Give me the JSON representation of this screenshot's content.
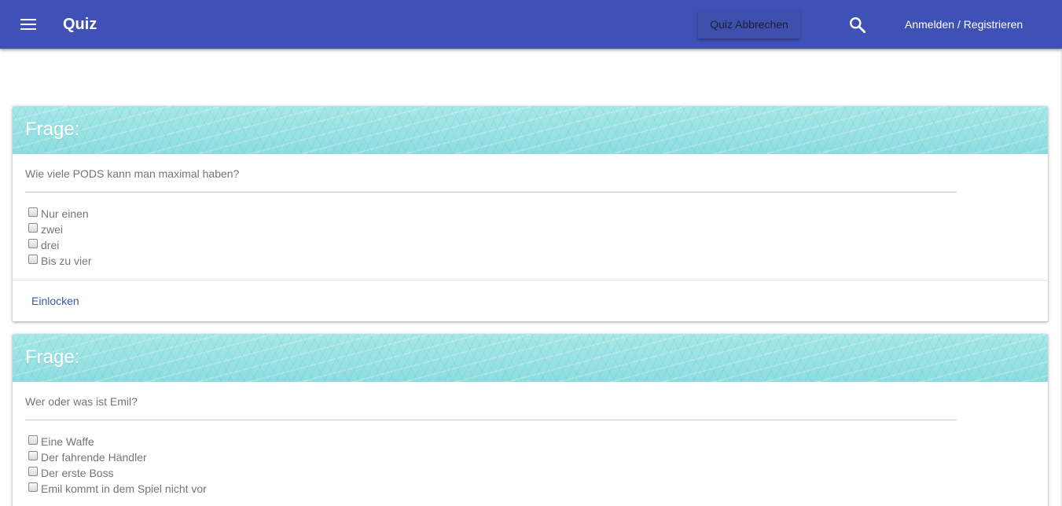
{
  "toolbar": {
    "title": "Quiz",
    "abort_label": "Quiz Abbrechen",
    "login_label": "Anmelden / Registrieren"
  },
  "questions": [
    {
      "header": "Frage:",
      "text": "Wie viele PODS kann man maximal haben?",
      "options": [
        "Nur einen",
        "zwei",
        "drei",
        "Bis zu vier"
      ],
      "action": "Einlocken"
    },
    {
      "header": "Frage:",
      "text": "Wer oder was ist Emil?",
      "options": [
        "Eine Waffe",
        "Der fahrende Händler",
        "Der erste Boss",
        "Emil kommt in dem Spiel nicht vor"
      ]
    }
  ],
  "colors": {
    "primary": "#3f51b5",
    "card_header": "#9fe3e5",
    "muted_text": "#757575"
  },
  "icons": {
    "menu": "hamburger-menu-icon",
    "search": "search-icon",
    "checkbox": "checkbox-unchecked"
  }
}
